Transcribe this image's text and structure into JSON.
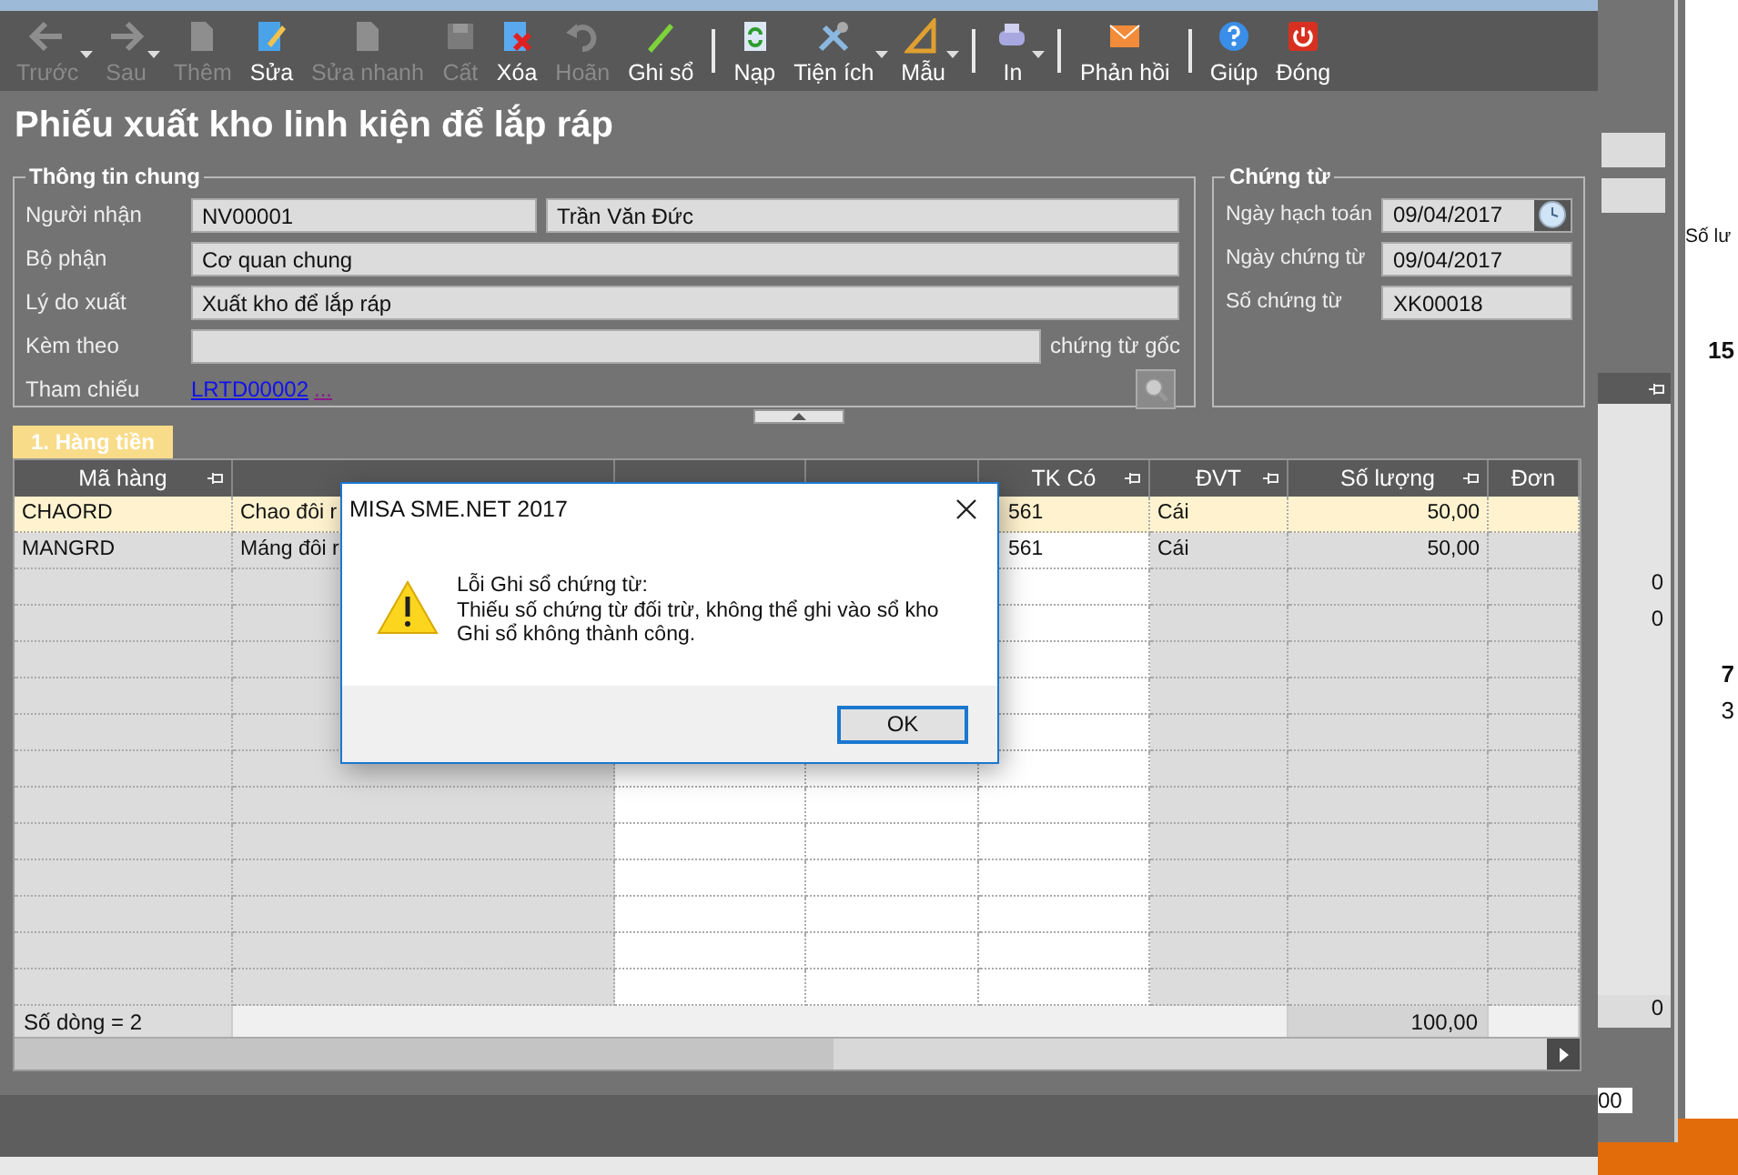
{
  "toolbar": [
    {
      "kind": "button",
      "label": "Trước",
      "disabled": true,
      "dropdown": true
    },
    {
      "kind": "button",
      "label": "Sau",
      "disabled": true,
      "dropdown": true
    },
    {
      "kind": "button",
      "label": "Thêm",
      "disabled": true,
      "dropdown": false
    },
    {
      "kind": "button",
      "label": "Sửa",
      "disabled": false,
      "dropdown": false
    },
    {
      "kind": "button",
      "label": "Sửa nhanh",
      "disabled": true,
      "dropdown": false
    },
    {
      "kind": "button",
      "label": "Cất",
      "disabled": true,
      "dropdown": false
    },
    {
      "kind": "button",
      "label": "Xóa",
      "disabled": false,
      "dropdown": false
    },
    {
      "kind": "button",
      "label": "Hoãn",
      "disabled": true,
      "dropdown": false
    },
    {
      "kind": "button",
      "label": "Ghi sổ",
      "disabled": false,
      "dropdown": false
    },
    {
      "kind": "separator"
    },
    {
      "kind": "button",
      "label": "Nạp",
      "disabled": false,
      "dropdown": false
    },
    {
      "kind": "button",
      "label": "Tiện ích",
      "disabled": false,
      "dropdown": true
    },
    {
      "kind": "button",
      "label": "Mẫu",
      "disabled": false,
      "dropdown": true
    },
    {
      "kind": "separator"
    },
    {
      "kind": "button",
      "label": "In",
      "disabled": false,
      "dropdown": true
    },
    {
      "kind": "separator"
    },
    {
      "kind": "button",
      "label": "Phản hồi",
      "disabled": false,
      "dropdown": false
    },
    {
      "kind": "separator"
    },
    {
      "kind": "button",
      "label": "Giúp",
      "disabled": false,
      "dropdown": false
    },
    {
      "kind": "button",
      "label": "Đóng",
      "disabled": false,
      "dropdown": false
    }
  ],
  "form_title": "Phiếu xuất kho linh kiện để lắp ráp",
  "general_info": {
    "title": "Thông tin chung",
    "rows": [
      {
        "kind": "fields",
        "label": "Người nhận",
        "values": [
          "NV00001",
          "Trần Văn Đức"
        ]
      },
      {
        "kind": "fields",
        "label": "Bộ phận",
        "values": [
          "Cơ quan chung"
        ]
      },
      {
        "kind": "fields",
        "label": "Lý do xuất",
        "values": [
          "Xuất kho để lắp ráp"
        ]
      },
      {
        "kind": "attachment",
        "label": "Kèm theo",
        "suffix": "chứng từ gốc"
      },
      {
        "kind": "reference",
        "label": "Tham chiếu",
        "link": "LRTD00002",
        "more": "..."
      }
    ]
  },
  "voucher": {
    "title": "Chứng từ",
    "rows": [
      {
        "kind": "date",
        "label": "Ngày hạch toán",
        "value": "09/04/2017"
      },
      {
        "kind": "text",
        "label": "Ngày chứng từ",
        "value": "09/04/2017"
      },
      {
        "kind": "text",
        "label": "Số chứng từ",
        "value": "XK00018"
      }
    ]
  },
  "tabs": [
    {
      "label": "1. Hàng tiền",
      "selected": true
    }
  ],
  "grid": {
    "columns": [
      {
        "kind": "header",
        "label": "Mã hàng",
        "pinned": true
      },
      {
        "kind": "covered"
      },
      {
        "kind": "covered"
      },
      {
        "kind": "covered"
      },
      {
        "kind": "header",
        "label": "TK Có",
        "pinned": true
      },
      {
        "kind": "header",
        "label": "ĐVT",
        "pinned": true
      },
      {
        "kind": "header",
        "label": "Số lượng",
        "pinned": true
      },
      {
        "kind": "header",
        "label": "Đơn",
        "pinned": false
      }
    ],
    "rows": [
      {
        "selected": true,
        "code": "CHAORD",
        "name": "Chao đôi r",
        "credit_account": "561",
        "unit": "Cái",
        "quantity": "50,00"
      },
      {
        "selected": false,
        "code": "MANGRD",
        "name": "Máng đôi r",
        "credit_account": "561",
        "unit": "Cái",
        "quantity": "50,00"
      }
    ],
    "footer": {
      "row_count": "Số dòng = 2",
      "total_quantity": "100,00"
    }
  },
  "dialog": {
    "title": "MISA SME.NET 2017",
    "message": [
      "Lỗi Ghi sổ chứng từ:",
      "Thiếu số chứng từ đối trừ, không thể ghi vào sổ kho",
      "Ghi sổ không thành công."
    ],
    "button": "OK"
  },
  "background_window_left": {
    "values": [
      "0",
      "0"
    ],
    "footer_value": "0"
  },
  "background_window_right": {
    "header": "Số lư",
    "values": [
      {
        "text": "15",
        "bold": true
      },
      {
        "text": "7",
        "bold": true
      },
      {
        "text": "3",
        "bold": false
      }
    ],
    "bottom_value": "00"
  }
}
